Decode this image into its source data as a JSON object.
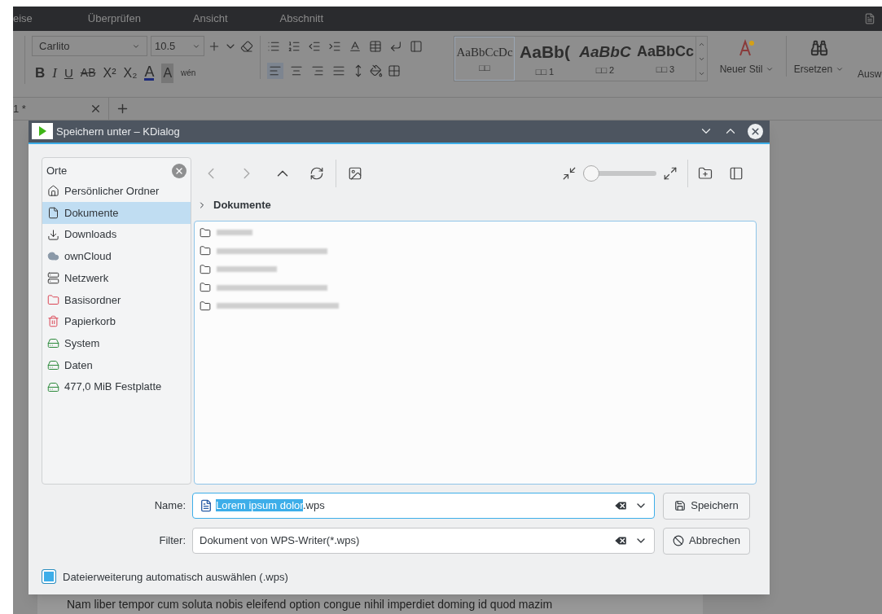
{
  "menu": [
    "eise",
    "Überprüfen",
    "Ansicht",
    "Abschnitt"
  ],
  "ribbon": {
    "font": "Carlito",
    "size": "10.5",
    "format_row": [
      {
        "kind": "bold",
        "label": "B"
      },
      {
        "kind": "italic",
        "label": "I"
      },
      {
        "kind": "underline",
        "label": "U"
      },
      {
        "kind": "strike",
        "label": "AB"
      },
      {
        "kind": "super",
        "label": "X²"
      },
      {
        "kind": "sub",
        "label": "X₂"
      },
      {
        "kind": "color",
        "label": "A"
      },
      {
        "kind": "shade",
        "label": "A"
      },
      {
        "kind": "phonetic",
        "label": "wén"
      }
    ],
    "align": [
      {
        "kind": "left",
        "selected": true
      },
      {
        "kind": "center",
        "selected": false
      },
      {
        "kind": "right",
        "selected": false
      },
      {
        "kind": "justify",
        "selected": false
      }
    ],
    "styles": [
      {
        "preview": "AaBbCcDc",
        "caption": "□□",
        "kind": "serif",
        "selected": true
      },
      {
        "preview": "AaBb(",
        "caption": "□□ 1",
        "kind": "heading",
        "selected": false
      },
      {
        "preview": "AaBbC",
        "caption": "□□ 2",
        "kind": "italic",
        "selected": false
      },
      {
        "preview": "AaBbCc",
        "caption": "□□ 3",
        "kind": "bold",
        "selected": false
      }
    ],
    "new_style": "Neuer Stil",
    "replace": "Ersetzen",
    "select": "Ausw"
  },
  "doc_tab": {
    "label": "1 *"
  },
  "document_text": "Nam liber tempor cum soluta nobis eleifend option congue nihil imperdiet doming id quod mazim",
  "dialog": {
    "title": "Speichern unter – KDialog",
    "places_title": "Orte",
    "places": [
      {
        "label": "Persönlicher Ordner",
        "kind": "home",
        "selected": false
      },
      {
        "label": "Dokumente",
        "kind": "document",
        "selected": true
      },
      {
        "label": "Downloads",
        "kind": "download",
        "selected": false
      },
      {
        "label": "ownCloud",
        "kind": "cloud",
        "selected": false
      },
      {
        "label": "Netzwerk",
        "kind": "network",
        "selected": false
      },
      {
        "label": "Basisordner",
        "kind": "root",
        "selected": false
      },
      {
        "label": "Papierkorb",
        "kind": "trash",
        "selected": false
      },
      {
        "label": "System",
        "kind": "drive",
        "selected": false
      },
      {
        "label": "Daten",
        "kind": "drive",
        "selected": false
      },
      {
        "label": "477,0 MiB Festplatte",
        "kind": "drive",
        "selected": false
      }
    ],
    "breadcrumb": "Dokumente",
    "files": [
      {
        "kind": "folder"
      },
      {
        "kind": "folder"
      },
      {
        "kind": "folder"
      },
      {
        "kind": "folder"
      },
      {
        "kind": "folder"
      }
    ],
    "zoom": {
      "level": 0.0
    },
    "name": {
      "label": "Name:",
      "selected_text": "Lorem ipsum dolor",
      "rest_text": ".wps"
    },
    "filter": {
      "label": "Filter:",
      "value": "Dokument von WPS-Writer(*.wps)"
    },
    "buttons": [
      {
        "kind": "save",
        "label": "Speichern"
      },
      {
        "kind": "cancel",
        "label": "Abbrechen"
      }
    ],
    "auto_extension": {
      "label": "Dateierweiterung automatisch auswählen (.wps)",
      "checked": true
    }
  }
}
